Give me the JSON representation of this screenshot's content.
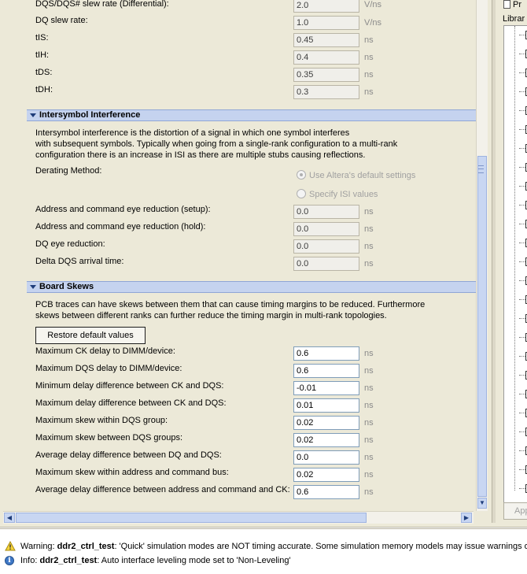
{
  "timing_rows": [
    {
      "label": "DQS/DQS# slew rate (Differential):",
      "value": "2.0",
      "unit": "V/ns"
    },
    {
      "label": "DQ slew rate:",
      "value": "1.0",
      "unit": "V/ns"
    },
    {
      "label": "tIS:",
      "value": "0.45",
      "unit": "ns"
    },
    {
      "label": "tIH:",
      "value": "0.4",
      "unit": "ns"
    },
    {
      "label": "tDS:",
      "value": "0.35",
      "unit": "ns"
    },
    {
      "label": "tDH:",
      "value": "0.3",
      "unit": "ns"
    }
  ],
  "isi": {
    "title": "Intersymbol Interference",
    "desc_lines": [
      "Intersymbol interference is the distortion of a signal in which one symbol interferes",
      "with subsequent symbols. Typically when going from a single-rank configuration to a multi-rank",
      "configuration there is an increase in ISI as there are multiple stubs causing reflections."
    ],
    "derating_label": "Derating Method:",
    "option_default": "Use Altera's default settings",
    "option_specify": "Specify ISI values",
    "rows": [
      {
        "label": "Address and command eye reduction (setup):",
        "value": "0.0",
        "unit": "ns"
      },
      {
        "label": "Address and command eye reduction (hold):",
        "value": "0.0",
        "unit": "ns"
      },
      {
        "label": "DQ eye reduction:",
        "value": "0.0",
        "unit": "ns"
      },
      {
        "label": "Delta DQS arrival time:",
        "value": "0.0",
        "unit": "ns"
      }
    ]
  },
  "skews": {
    "title": "Board Skews",
    "desc_lines": [
      "PCB traces can have skews between them that can cause timing margins to be reduced. Furthermore",
      "skews between different ranks can further reduce the timing margin in multi-rank topologies."
    ],
    "restore_label": "Restore default values",
    "rows": [
      {
        "label": "Maximum CK delay to DIMM/device:",
        "value": "0.6",
        "unit": "ns"
      },
      {
        "label": "Maximum DQS delay to DIMM/device:",
        "value": "0.6",
        "unit": "ns"
      },
      {
        "label": "Minimum delay difference between CK and DQS:",
        "value": "-0.01",
        "unit": "ns"
      },
      {
        "label": "Maximum delay difference between CK and DQS:",
        "value": "0.01",
        "unit": "ns"
      },
      {
        "label": "Maximum skew within DQS group:",
        "value": "0.02",
        "unit": "ns"
      },
      {
        "label": "Maximum skew between DQS groups:",
        "value": "0.02",
        "unit": "ns"
      },
      {
        "label": "Average delay difference between DQ and DQS:",
        "value": "0.0",
        "unit": "ns"
      },
      {
        "label": "Maximum skew within address and command bus:",
        "value": "0.02",
        "unit": "ns"
      },
      {
        "label": "Average delay difference between address and command and CK:",
        "value": "0.6",
        "unit": "ns"
      }
    ]
  },
  "right_panel": {
    "header_text": "Pr",
    "library_label": "Librar",
    "apply_label": "App"
  },
  "messages": {
    "warning": {
      "prefix": "Warning: ",
      "name": "ddr2_ctrl_test",
      "text": ": 'Quick' simulation modes are NOT timing accurate. Some simulation memory models may issue warnings or e"
    },
    "info": {
      "prefix": "Info: ",
      "name": "ddr2_ctrl_test",
      "text": ": Auto interface leveling mode set to 'Non-Leveling'"
    }
  }
}
